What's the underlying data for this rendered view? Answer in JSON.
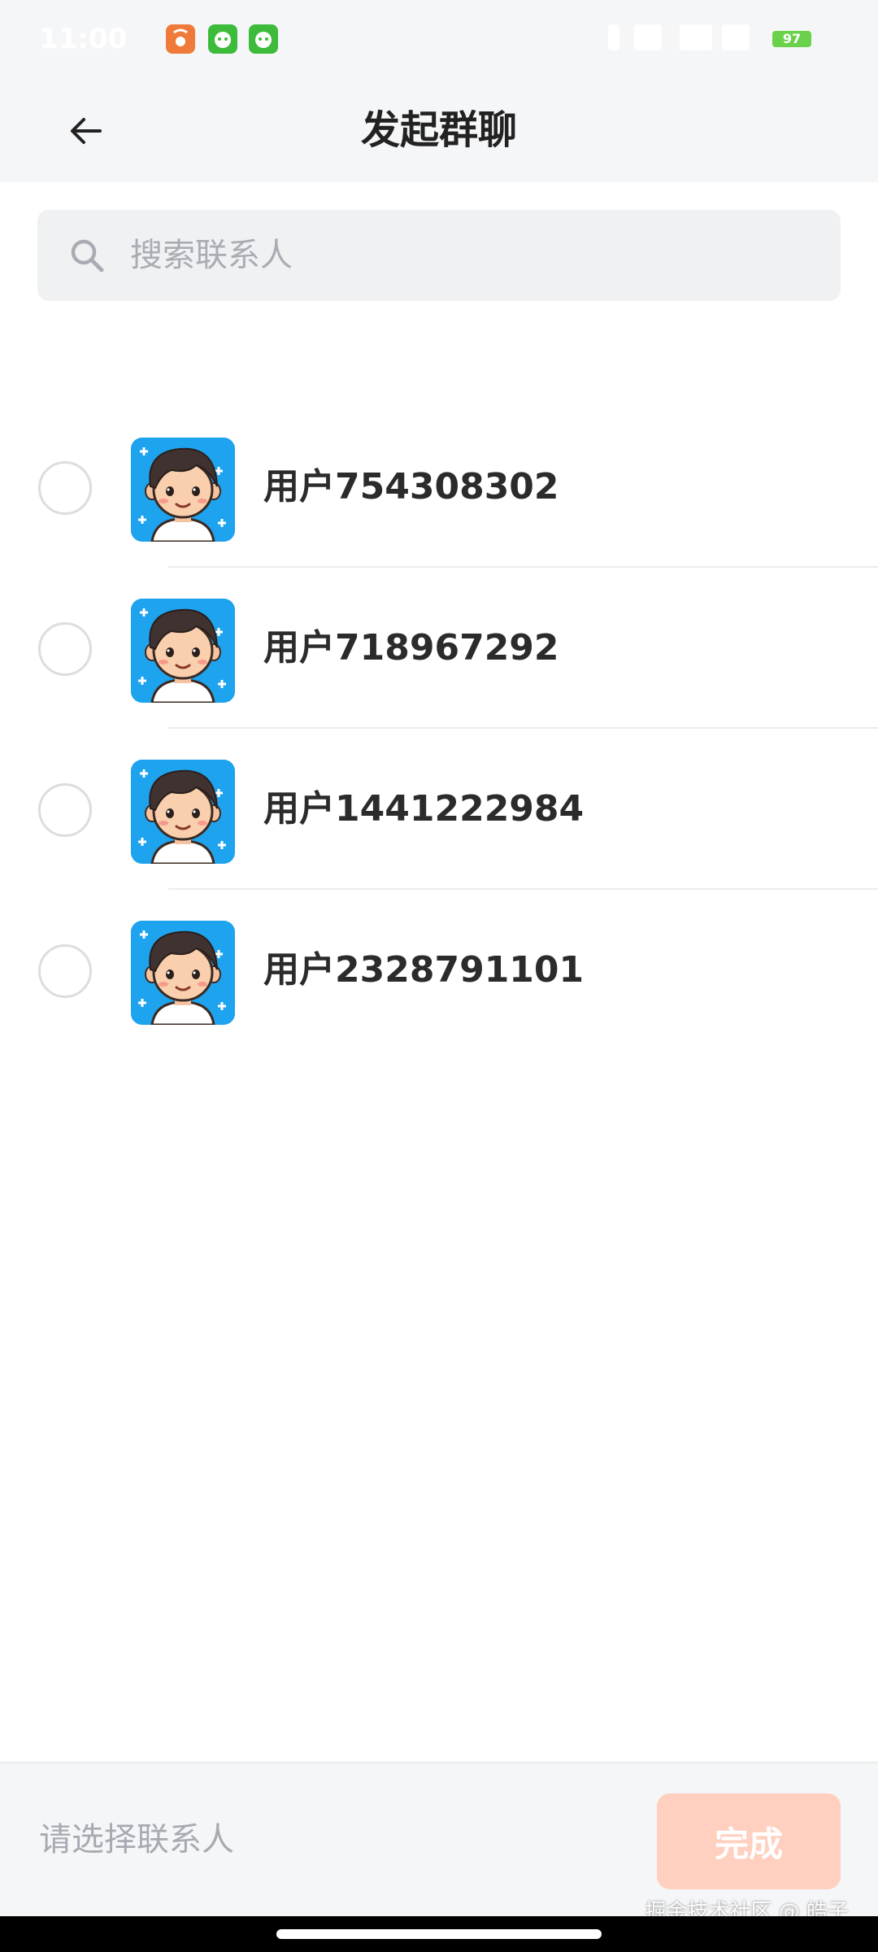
{
  "status_bar": {
    "time": "11:00",
    "battery": "97",
    "app_icons": [
      "taobao-icon",
      "wechat-bot-icon",
      "wechat-bot-icon"
    ]
  },
  "header": {
    "back_icon": "arrow-left-icon",
    "title": "发起群聊"
  },
  "search": {
    "placeholder": "搜索联系人",
    "value": ""
  },
  "contacts": [
    {
      "name": "用户754308302",
      "selected": false
    },
    {
      "name": "用户718967292",
      "selected": false
    },
    {
      "name": "用户1441222984",
      "selected": false
    },
    {
      "name": "用户2328791101",
      "selected": false
    }
  ],
  "footer": {
    "hint": "请选择联系人",
    "done_label": "完成"
  },
  "watermark": "掘金技术社区 @ 皓子",
  "colors": {
    "background": "#ffffff",
    "header_bg": "#f5f6f8",
    "avatar_bg": "#1ea3ee",
    "done_button_disabled": "#ffd0c0",
    "text_primary": "#2b2b2b",
    "text_placeholder": "#a9adb3"
  }
}
